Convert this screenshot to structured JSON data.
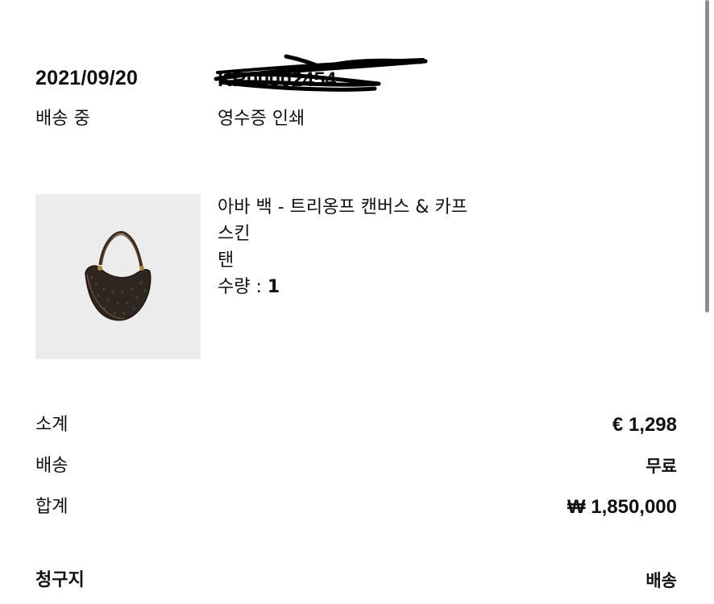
{
  "order": {
    "date": "2021/09/20",
    "number_redacted": "KR00002454",
    "status": "배송 중",
    "receipt_link": "영수증 인쇄"
  },
  "product": {
    "name": "아바 백 - 트리옹프 캔버스 & 카프스킨",
    "color": "탠",
    "qty_label": "수량 : ",
    "qty_value": "1"
  },
  "summary": {
    "subtotal_label": "소계",
    "subtotal_value": "€ 1,298",
    "shipping_label": "배송",
    "shipping_value": "무료",
    "total_label": "합계",
    "total_value": "₩ 1,850,000"
  },
  "sections": {
    "billing": "청구지",
    "shipping": "배송"
  },
  "colors": {
    "image_bg": "#ececec",
    "text": "#111111"
  }
}
